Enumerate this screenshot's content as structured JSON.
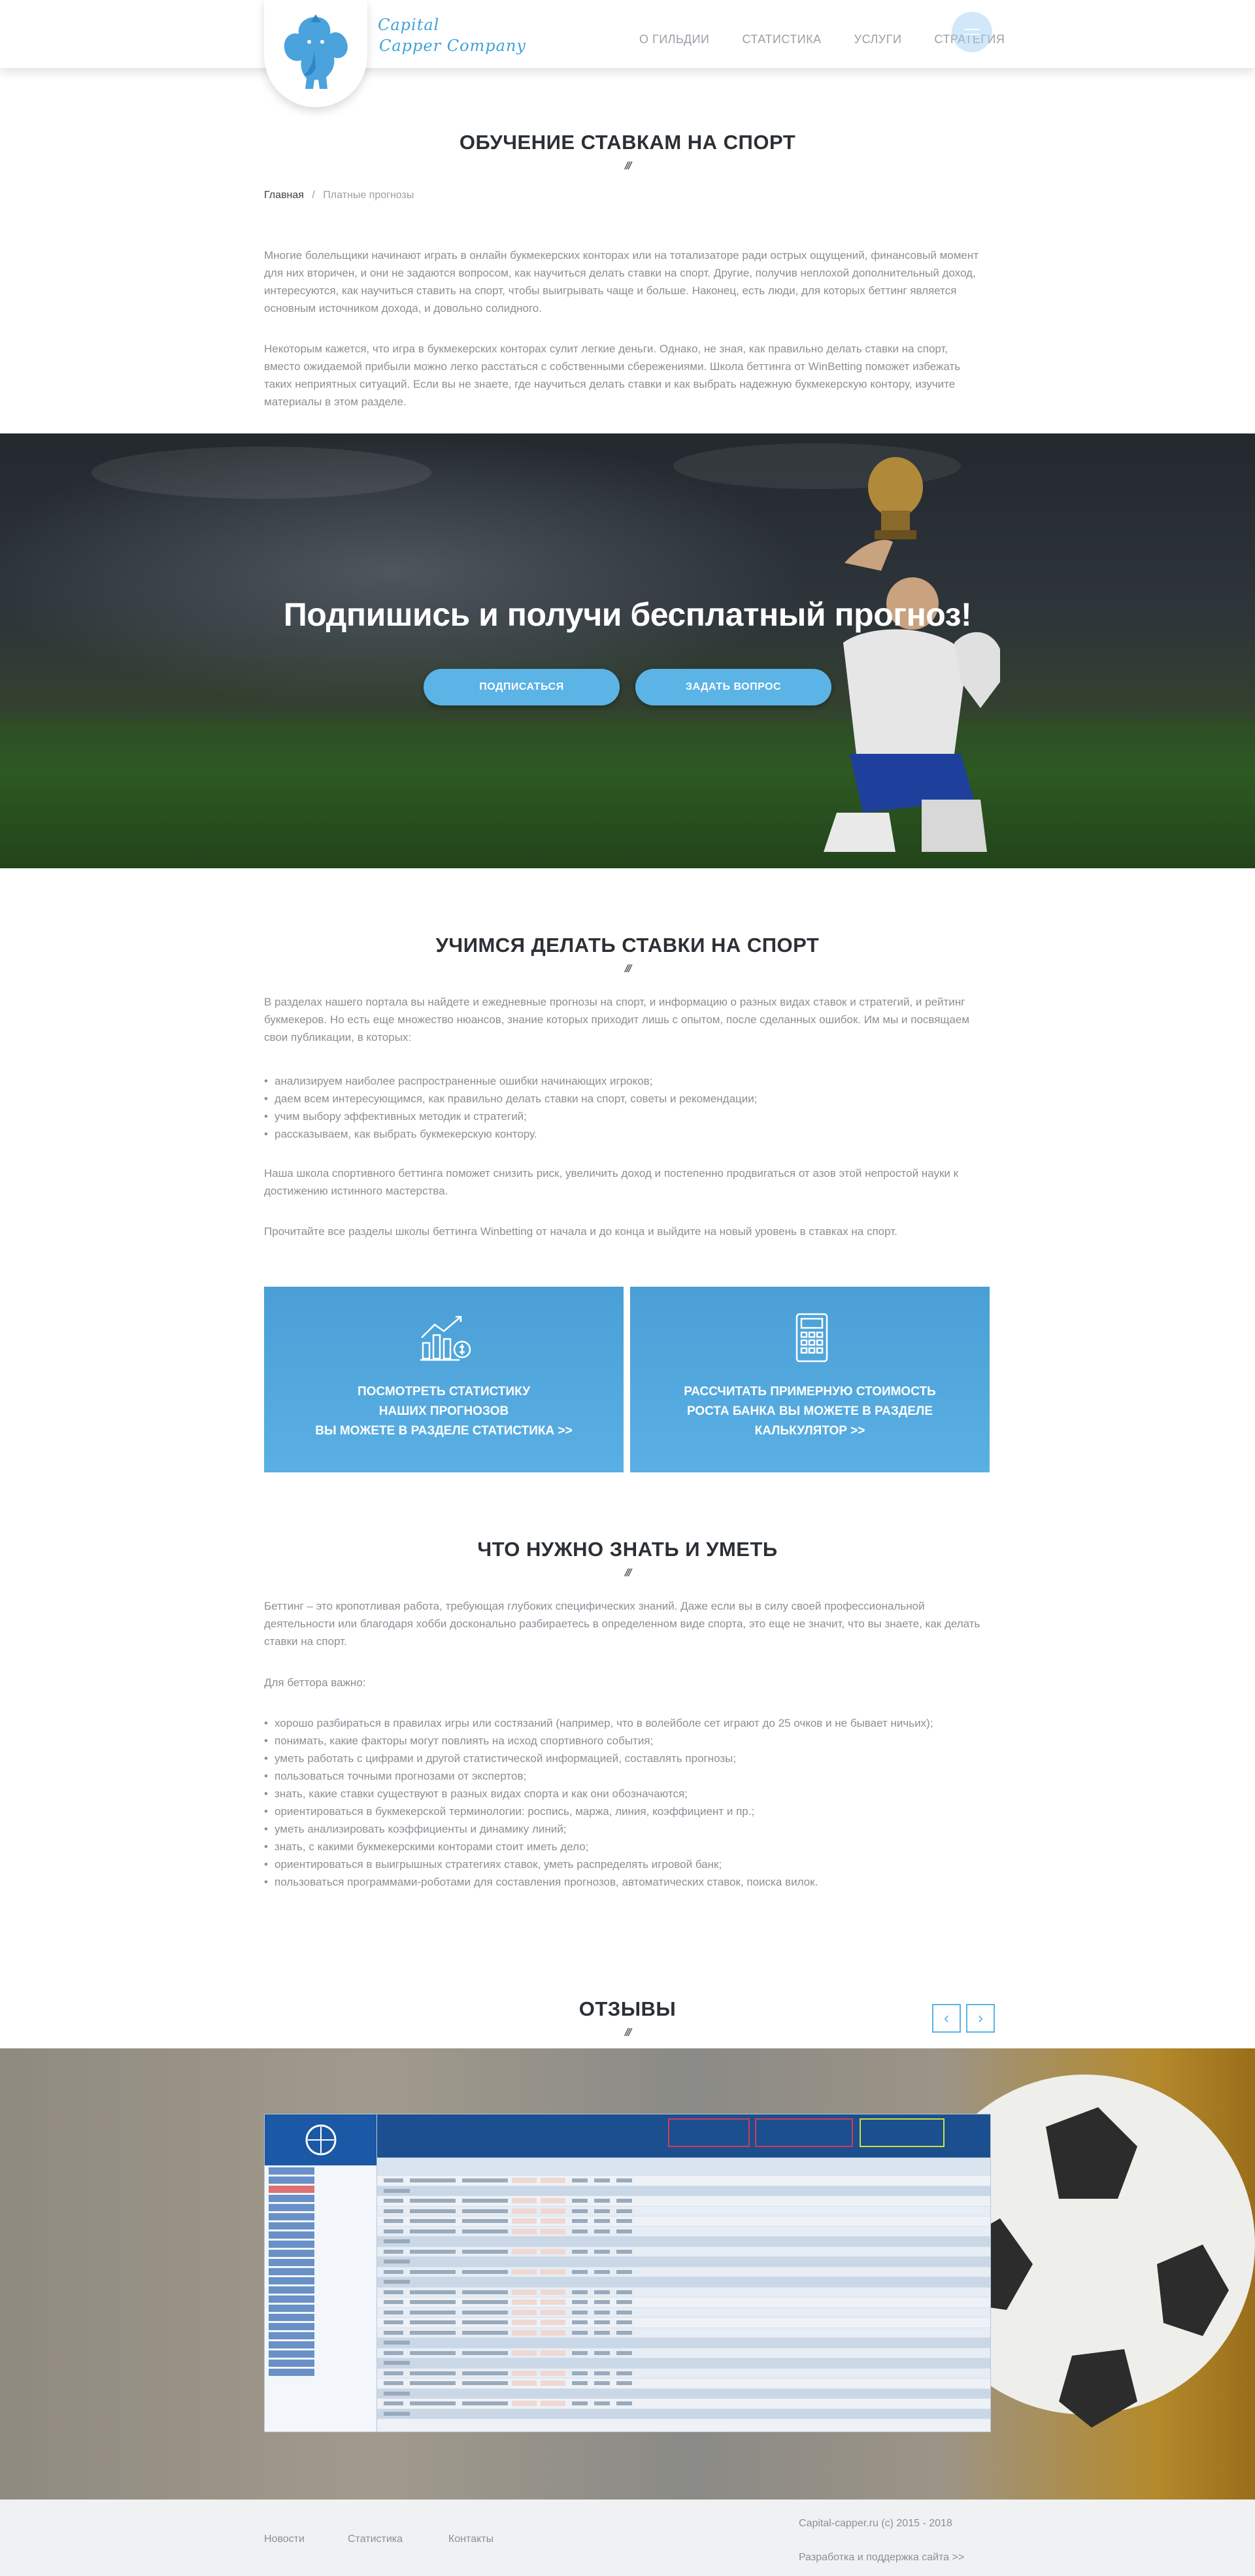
{
  "header": {
    "logo_line1": "Capital",
    "logo_line2": "Capper Company",
    "nav": [
      "О ГИЛЬДИИ",
      "СТАТИСТИКА",
      "УСЛУГИ",
      "СТРАТЕГИЯ"
    ]
  },
  "intro": {
    "title": "ОБУЧЕНИЕ СТАВКАМ НА СПОРТ",
    "divider": "///",
    "breadcrumb": {
      "home": "Главная",
      "separator": "/",
      "current": "Платные прогнозы"
    },
    "p1": "Многие болельщики начинают играть в онлайн букмекерских конторах или на тотализаторе ради острых ощущений, финансовый момент для них вторичен, и они не задаются вопросом, как научиться делать ставки на спорт. Другие, получив неплохой дополнительный доход, интересуются, как научиться ставить на спорт, чтобы выигрывать чаще и больше. Наконец, есть люди, для которых беттинг является основным источником дохода, и довольно солидного.",
    "p2": "Некоторым кажется, что игра в букмекерских конторах сулит легкие деньги. Однако, не зная, как правильно делать ставки на спорт, вместо ожидаемой прибыли можно легко расстаться с собственными сбережениями. Школа беттинга от WinBetting поможет избежать таких неприятных ситуаций. Если вы не знаете, где научиться делать ставки и как выбрать надежную букмекерскую контору, изучите материалы в этом разделе."
  },
  "banner": {
    "title": "Подпишись и получи бесплатный прогноз!",
    "subscribe_label": "ПОДПИСАТЬСЯ",
    "ask_label": "ЗАДАТЬ ВОПРОС"
  },
  "learn": {
    "title": "УЧИМСЯ ДЕЛАТЬ СТАВКИ НА СПОРТ",
    "divider": "///",
    "p1": "В разделах нашего портала вы найдете и ежедневные прогнозы на спорт, и информацию о разных видах ставок и стратегий, и рейтинг букмекеров. Но есть еще множество нюансов, знание которых приходит лишь с опытом, после сделанных ошибок. Им мы и посвящаем свои публикации, в которых:",
    "bullets": [
      "анализируем наиболее распространенные ошибки начинающих игроков;",
      "даем всем интересующимся, как правильно делать ставки на спорт, советы и рекомендации;",
      "учим выбору эффективных методик и стратегий;",
      "рассказываем, как выбрать букмекерскую контору."
    ],
    "p2": "Наша школа спортивного беттинга поможет снизить риск, увеличить доход и постепенно продвигаться от азов этой непростой науки к достижению истинного мастерства.",
    "p3": "Прочитайте все разделы школы беттинга Winbetting от начала и до конца и выйдите на новый уровень в ставках на спорт."
  },
  "cards": [
    {
      "icon": "chart-growth-icon",
      "lines": [
        "ПОСМОТРЕТЬ СТАТИСТИКУ",
        "НАШИХ ПРОГНОЗОВ",
        "ВЫ МОЖЕТЕ В РАЗДЕЛЕ СТАТИСТИКА >>"
      ]
    },
    {
      "icon": "calculator-icon",
      "lines": [
        "РАССЧИТАТЬ ПРИМЕРНУЮ СТОИМОСТЬ",
        "РОСТА БАНКА ВЫ МОЖЕТЕ В РАЗДЕЛЕ",
        "КАЛЬКУЛЯТОР >>"
      ]
    }
  ],
  "knowledge": {
    "title": "ЧТО НУЖНО ЗНАТЬ И УМЕТЬ",
    "divider": "///",
    "p1": "Беттинг – это кропотливая работа, требующая глубоких специфических знаний. Даже если вы в силу своей профессиональной деятельности или благодаря хобби досконально разбираетесь в определенном виде спорта, это еще не значит, что вы знаете, как делать ставки на спорт.",
    "p2": "Для беттора важно:",
    "bullets": [
      "хорошо разбираться в правилах игры или состязаний (например, что в волейболе сет играют до 25 очков и не бывает ничьих);",
      "понимать, какие факторы могут повлиять на исход спортивного события;",
      "уметь работать с цифрами и другой статистической информацией, составлять прогнозы;",
      "пользоваться точными прогнозами от экспертов;",
      "знать, какие ставки существуют в разных видах спорта и как они обозначаются;",
      "ориентироваться в букмекерской терминологии: роспись, маржа, линия, коэффициент и пр.;",
      "уметь анализировать коэффициенты и динамику линий;",
      "знать, с какими букмекерскими конторами стоит иметь дело;",
      "ориентироваться в выигрышных стратегиях ставок, уметь распределять игровой банк;",
      "пользоваться программами-роботами для составления прогнозов, автоматических ставок, поиска вилок."
    ]
  },
  "reviews": {
    "title": "ОТЗЫВЫ",
    "divider": "///",
    "prev": "‹",
    "next": "›"
  },
  "footer": {
    "links": [
      "Новости",
      "Статистика",
      "Контакты"
    ],
    "copyright": "Capital-capper.ru (c) 2015 - 2018",
    "developer": "Разработка и поддержка сайта >>"
  }
}
